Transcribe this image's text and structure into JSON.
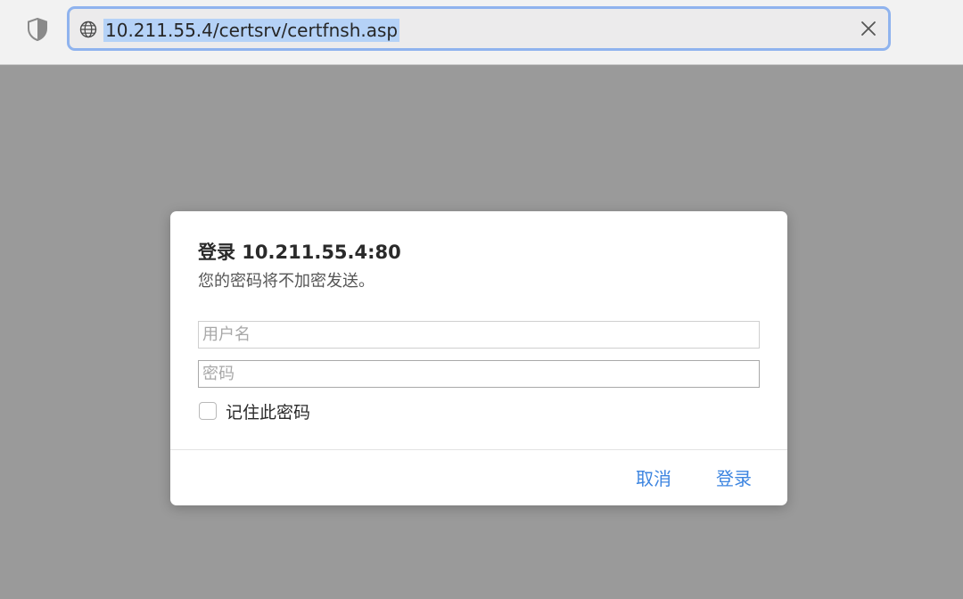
{
  "browser": {
    "address_bar": {
      "url": "10.211.55.4/certsrv/certfnsh.asp",
      "icon": "globe-icon",
      "clear_icon": "close-icon"
    },
    "shield_icon": "shield-icon"
  },
  "dialog": {
    "title": "登录 10.211.55.4:80",
    "subtitle": "您的密码将不加密发送。",
    "username_placeholder": "用户名",
    "password_placeholder": "密码",
    "remember_label": "记住此密码",
    "remember_checked": false,
    "cancel_label": "取消",
    "login_label": "登录"
  },
  "colors": {
    "accent": "#3d85e0",
    "address_focus_ring": "#8fb3ee",
    "url_selection": "#b5d2f7",
    "overlay_background": "#9a9a9a"
  }
}
